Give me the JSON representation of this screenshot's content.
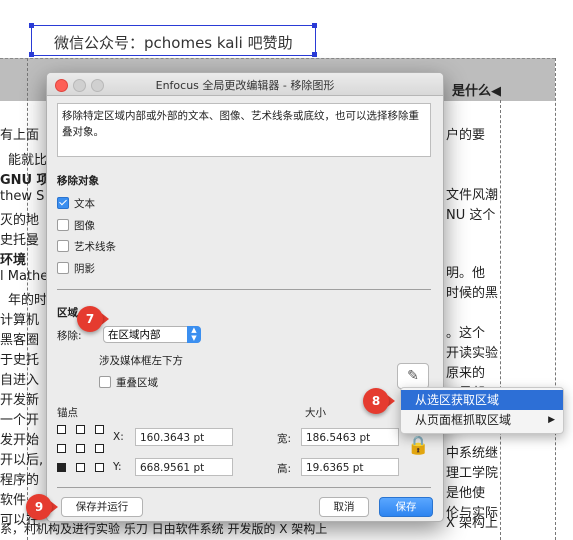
{
  "top_label": "微信公众号：pchomes   kali 吧赞助",
  "background_doc": {
    "header_right": "是什么◀",
    "left_fragments": [
      "有上面",
      "能就比",
      "GNU 项",
      "thew S",
      "灭的地",
      "史托曼",
      "环境",
      "l Mathe",
      "年的时",
      "计算机",
      "黑客圈",
      "于史托",
      "自进入",
      "开发新",
      "一个开",
      "发开始",
      "开以后,",
      "程序的",
      "软件,",
      "可以在"
    ],
    "right_fragments": [
      "户的要",
      "文件风潮",
      "NU 这个",
      "明。他",
      "时候的黑",
      "。这个",
      "开读实验",
      "原来的",
      "干是帮",
      "中系统继",
      "理工学院",
      "是他使",
      "伦与实际",
      "X 架构上"
    ],
    "bottom_line": "系，利机构及进行实验 乐刀 日由软件系统 开发版的 X 架构上"
  },
  "dialog": {
    "title": "Enfocus 全局更改编辑器 - 移除图形",
    "description": "移除特定区域内部或外部的文本、图像、艺术线条或底纹，也可以选择移除重叠对象。",
    "remove_objects_title": "移除对象",
    "checkboxes": [
      {
        "label": "文本",
        "checked": true
      },
      {
        "label": "图像",
        "checked": false
      },
      {
        "label": "艺术线条",
        "checked": false
      },
      {
        "label": "阴影",
        "checked": false
      }
    ],
    "region_title": "区域",
    "remove_label": "移除:",
    "remove_select_value": "在区域内部",
    "touching_label": "涉及媒体框左下方",
    "overlap_label": "重叠区域",
    "overlap_checked": false,
    "anchor_label": "锚点",
    "size_label": "大小",
    "x_label": "X:",
    "x_value": "160.3643 pt",
    "y_label": "Y:",
    "y_value": "668.9561 pt",
    "width_label": "宽:",
    "width_value": "186.5463 pt",
    "height_label": "高:",
    "height_value": "19.6365 pt",
    "save_run_button": "保存并运行",
    "cancel_button": "取消",
    "save_button": "保存"
  },
  "context_menu": {
    "items": [
      {
        "label": "从选区获取区域",
        "active": true,
        "submenu": false
      },
      {
        "label": "从页面框抓取区域",
        "active": false,
        "submenu": true
      }
    ]
  },
  "callouts": [
    "7",
    "8",
    "9"
  ],
  "colors": {
    "accent": "#3b8ff0",
    "callout_red": "#e53b2f",
    "menu_highlight": "#2d6fd6",
    "selection_blue": "#2a3bd6"
  }
}
